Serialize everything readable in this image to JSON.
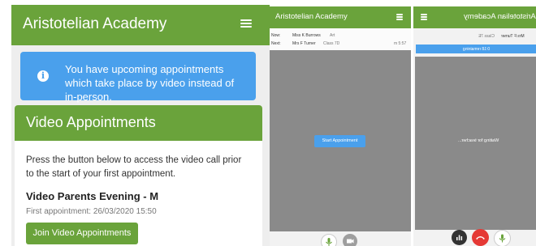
{
  "panel1": {
    "app_title": "Aristotelian Academy",
    "alert_text": "You have upcoming appointments which take place by video instead of in-person.",
    "card_title": "Video Appointments",
    "description": "Press the button below to access the video call prior to the start of your first appointment.",
    "event_title": "Video Parents Evening - M",
    "first_appointment": "First appointment: 26/03/2020 15:50",
    "join_button": "Join Video Appointments"
  },
  "panel2": {
    "app_title": "Aristotelian Academy",
    "now_label": "Now:",
    "now_name": "Miss K Burrows",
    "now_subject": "Art",
    "next_label": "Next:",
    "next_name": "Mrs F Turner",
    "next_subject": "Class 7D",
    "time": "m 5:57",
    "start_button": "Start Appointment"
  },
  "panel3": {
    "app_title": "Aristotelian Academy",
    "teacher": "Mrs F Turner",
    "class": "Class 7E",
    "status_bar": "0:18 remaining",
    "waiting_text": "Waiting for teacher..."
  },
  "colors": {
    "brand_green": "#6aa33b",
    "info_blue": "#4aa0ec",
    "end_call_red": "#e53935",
    "video_grey": "#8a8a8a"
  },
  "icons": [
    "menu-icon",
    "info-icon",
    "microphone-icon",
    "camera-icon",
    "end-call-icon",
    "stats-icon"
  ]
}
